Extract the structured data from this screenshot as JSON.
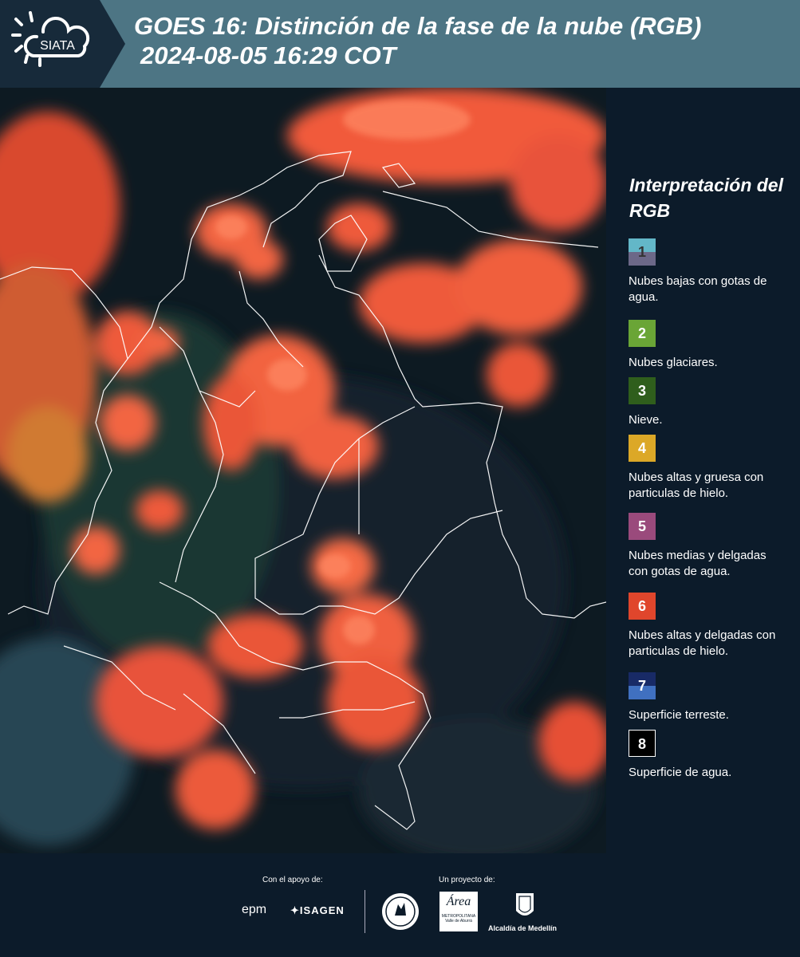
{
  "header": {
    "logo_text": "SIATA",
    "title_line1": "GOES 16: Distinción de la fase de la nube (RGB)",
    "title_line2": "2024-08-05 16:29 COT"
  },
  "legend": {
    "title": "Interpretación del RGB",
    "items": [
      {
        "number": "1",
        "label": "Nubes bajas con gotas de agua.",
        "color": "#63b7c8"
      },
      {
        "number": "2",
        "label": "Nubes glaciares.",
        "color": "#6aa536"
      },
      {
        "number": "3",
        "label": "Nieve.",
        "color": "#2f5e1c"
      },
      {
        "number": "4",
        "label": "Nubes altas y gruesa con particulas de hielo.",
        "color": "#dca827"
      },
      {
        "number": "5",
        "label": "Nubes medias y delgadas con gotas de agua.",
        "color": "#9a4a7c"
      },
      {
        "number": "6",
        "label": "Nubes altas y delgadas con particulas de hielo.",
        "color": "#e0462c"
      },
      {
        "number": "7",
        "label": "Superficie terreste.",
        "color": "#182a66"
      },
      {
        "number": "8",
        "label": "Superficie de agua.",
        "color": "#000000"
      }
    ]
  },
  "footer": {
    "support_label": "Con el apoyo de:",
    "project_label": "Un proyecto de:",
    "sponsors": [
      "epm",
      "ISAGEN"
    ],
    "partner_area": "Área",
    "partner_area_sub": "METROPOLITANA",
    "partner_area_sub2": "Valle de Aburrá",
    "partner_alcaldia": "Alcaldía de Medellín"
  }
}
